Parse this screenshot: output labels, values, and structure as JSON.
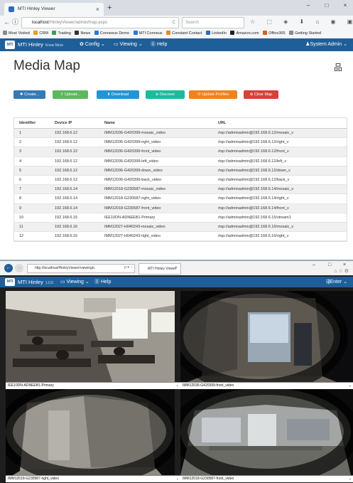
{
  "firefox": {
    "tab_title": "MTI Hinley Viewer",
    "tab_close": "×",
    "new_tab": "+",
    "window_controls": [
      "–",
      "□",
      "×"
    ],
    "url_host": "localhost",
    "url_path": "/HinleyViewer/admin/map.aspx",
    "search_placeholder": "Search",
    "toolbar_icons": "☆ ⬚ ◈ ⬇ ⌂ ◉ ▣ ◍ ≡",
    "bookmarks": [
      {
        "label": "Most Visited",
        "color": "#8a8a8a"
      },
      {
        "label": "CRM",
        "color": "#e4a21c"
      },
      {
        "label": "Trading",
        "color": "#3aa04a"
      },
      {
        "label": "News",
        "color": "#333333"
      },
      {
        "label": "Conneeus Demo",
        "color": "#2a7bd4"
      },
      {
        "label": "MTI Conneus",
        "color": "#2a7bd4"
      },
      {
        "label": "Constant Contact",
        "color": "#e98a1d"
      },
      {
        "label": "LinkedIn",
        "color": "#2a6ebb"
      },
      {
        "label": "Amazon.com",
        "color": "#222222"
      },
      {
        "label": "Office365",
        "color": "#e45a1d"
      },
      {
        "label": "Getting Started",
        "color": "#8a8a8a"
      }
    ]
  },
  "app": {
    "brand": "MTI Hinley",
    "brand_sub": "Know More",
    "nav": {
      "config": "✿ Config ⌄",
      "viewing": "▭ Viewing ⌄",
      "help": "⓪ Help"
    },
    "user": "♟System Admin ⌄"
  },
  "page": {
    "title": "Media Map",
    "network_icon": "品",
    "buttons": [
      {
        "label": "✚ Create...",
        "color": "#337ab7"
      },
      {
        "label": "⇪ Upload...",
        "color": "#5cb85c"
      },
      {
        "label": "⬇ Download",
        "color": "#2196d3"
      },
      {
        "label": "≋ Discover",
        "color": "#1abc9c"
      },
      {
        "label": "⟳ Update Profiles",
        "color": "#f0821e"
      },
      {
        "label": "⊗ Clear Map",
        "color": "#d9403a"
      }
    ],
    "table": {
      "headers": [
        "Identifier",
        "Device IP",
        "Name",
        "URL"
      ],
      "rows": [
        [
          "1",
          "192.168.6.12",
          "IMM12036-G420399-mosaic_video",
          "rtsp://adminadmin@192.168.6.12/mosaic_v"
        ],
        [
          "2",
          "192.168.6.12",
          "IMM12036-G420399-right_video",
          "rtsp://adminadmin@192.168.6.12/right_v"
        ],
        [
          "3",
          "192.168.6.12",
          "IMM12036-G420399-front_video",
          "rtsp://adminadmin@192.168.6.12/front_v"
        ],
        [
          "4",
          "192.168.6.12",
          "IMM12036-G420399-left_video",
          "rtsp://adminadmin@192.168.6.12/left_v"
        ],
        [
          "5",
          "192.168.6.12",
          "IMM12036-G420399-down_video",
          "rtsp://adminadmin@192.168.6.12/down_v"
        ],
        [
          "6",
          "192.168.6.12",
          "IMM12036-G420399-back_video",
          "rtsp://adminadmin@192.168.6.12/back_v"
        ],
        [
          "7",
          "192.168.6.14",
          "IMM12018-G230587-mosaic_video",
          "rtsp://adminadmin@192.168.6.14/mosaic_v"
        ],
        [
          "8",
          "192.168.6.14",
          "IMM12018-G230587-right_video",
          "rtsp://adminadmin@192.168.6.14/right_v"
        ],
        [
          "9",
          "192.168.6.14",
          "IMM12018-G230587-front_video",
          "rtsp://adminadmin@192.168.6.14/front_v"
        ],
        [
          "10",
          "192.168.6.15",
          "IEE10DN-ADNEEB1-Primary",
          "rtsp://adminadmin@192.168.6.15/stream1"
        ],
        [
          "11",
          "192.168.6.16",
          "IMM12027-H040243-mosaic_video",
          "rtsp://adminadmin@192.168.6.16/mosaic_v"
        ],
        [
          "12",
          "192.168.6.16",
          "IMM12027-H040243-right_video",
          "rtsp://adminadmin@192.168.6.16/right_v"
        ]
      ]
    }
  },
  "ie": {
    "url": "http://localhost/HinleyViewer/viewing/c",
    "url_controls": "ρ ▾ ♂",
    "tab_title": "MTI Hinley Viewer",
    "tab_close": "×",
    "window_controls": [
      "–",
      "□",
      "×"
    ],
    "tools": "⌂☆⚙",
    "brand": "MTI Hinley",
    "brand_sub": "1.0.0",
    "nav_viewing": "▭ Viewing ⌄",
    "nav_help": "⓪ Help",
    "nav_enter": "⇶Enter ⌄",
    "cameras": [
      {
        "label": "IEE10DN-ADNEEB1-Primary"
      },
      {
        "label": "IMM12036-G420399-front_video"
      },
      {
        "label": "IMM12018-G230587-right_video"
      },
      {
        "label": "IMM12018-G230587-front_video"
      }
    ],
    "dropdown_glyph": "⌄"
  },
  "colors": {
    "nav_blue": "#1f5f99",
    "row_stripe": "#f0f0f0"
  }
}
